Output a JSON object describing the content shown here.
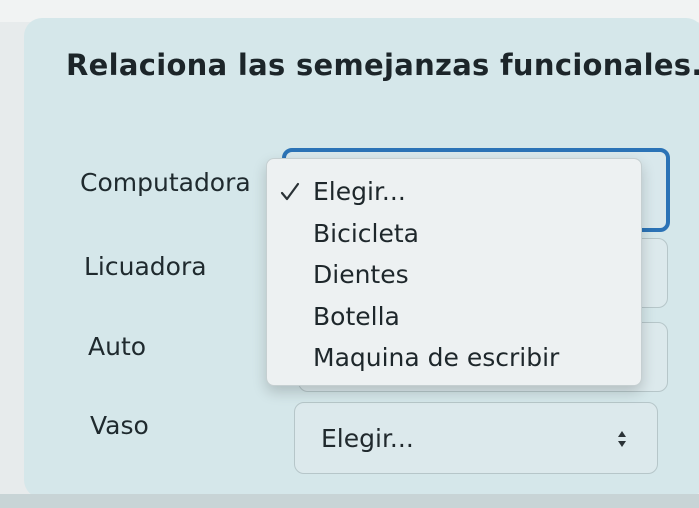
{
  "question": {
    "title": "Relaciona las semejanzas funcionales."
  },
  "terms": [
    {
      "label": "Computadora"
    },
    {
      "label": "Licuadora"
    },
    {
      "label": "Auto"
    },
    {
      "label": "Vaso"
    }
  ],
  "dropdown": {
    "options": [
      "Elegir...",
      "Bicicleta",
      "Dientes",
      "Botella",
      "Maquina de escribir"
    ],
    "selected": "Elegir..."
  },
  "select_vaso": {
    "value": "Elegir..."
  },
  "colors": {
    "card_background": "#d5e7ea",
    "focus_ring": "#2b73b6",
    "menu_background": "#edf1f2"
  },
  "icons": {
    "selected_marker": "check-icon",
    "select_arrows": "updown-arrows-icon"
  }
}
